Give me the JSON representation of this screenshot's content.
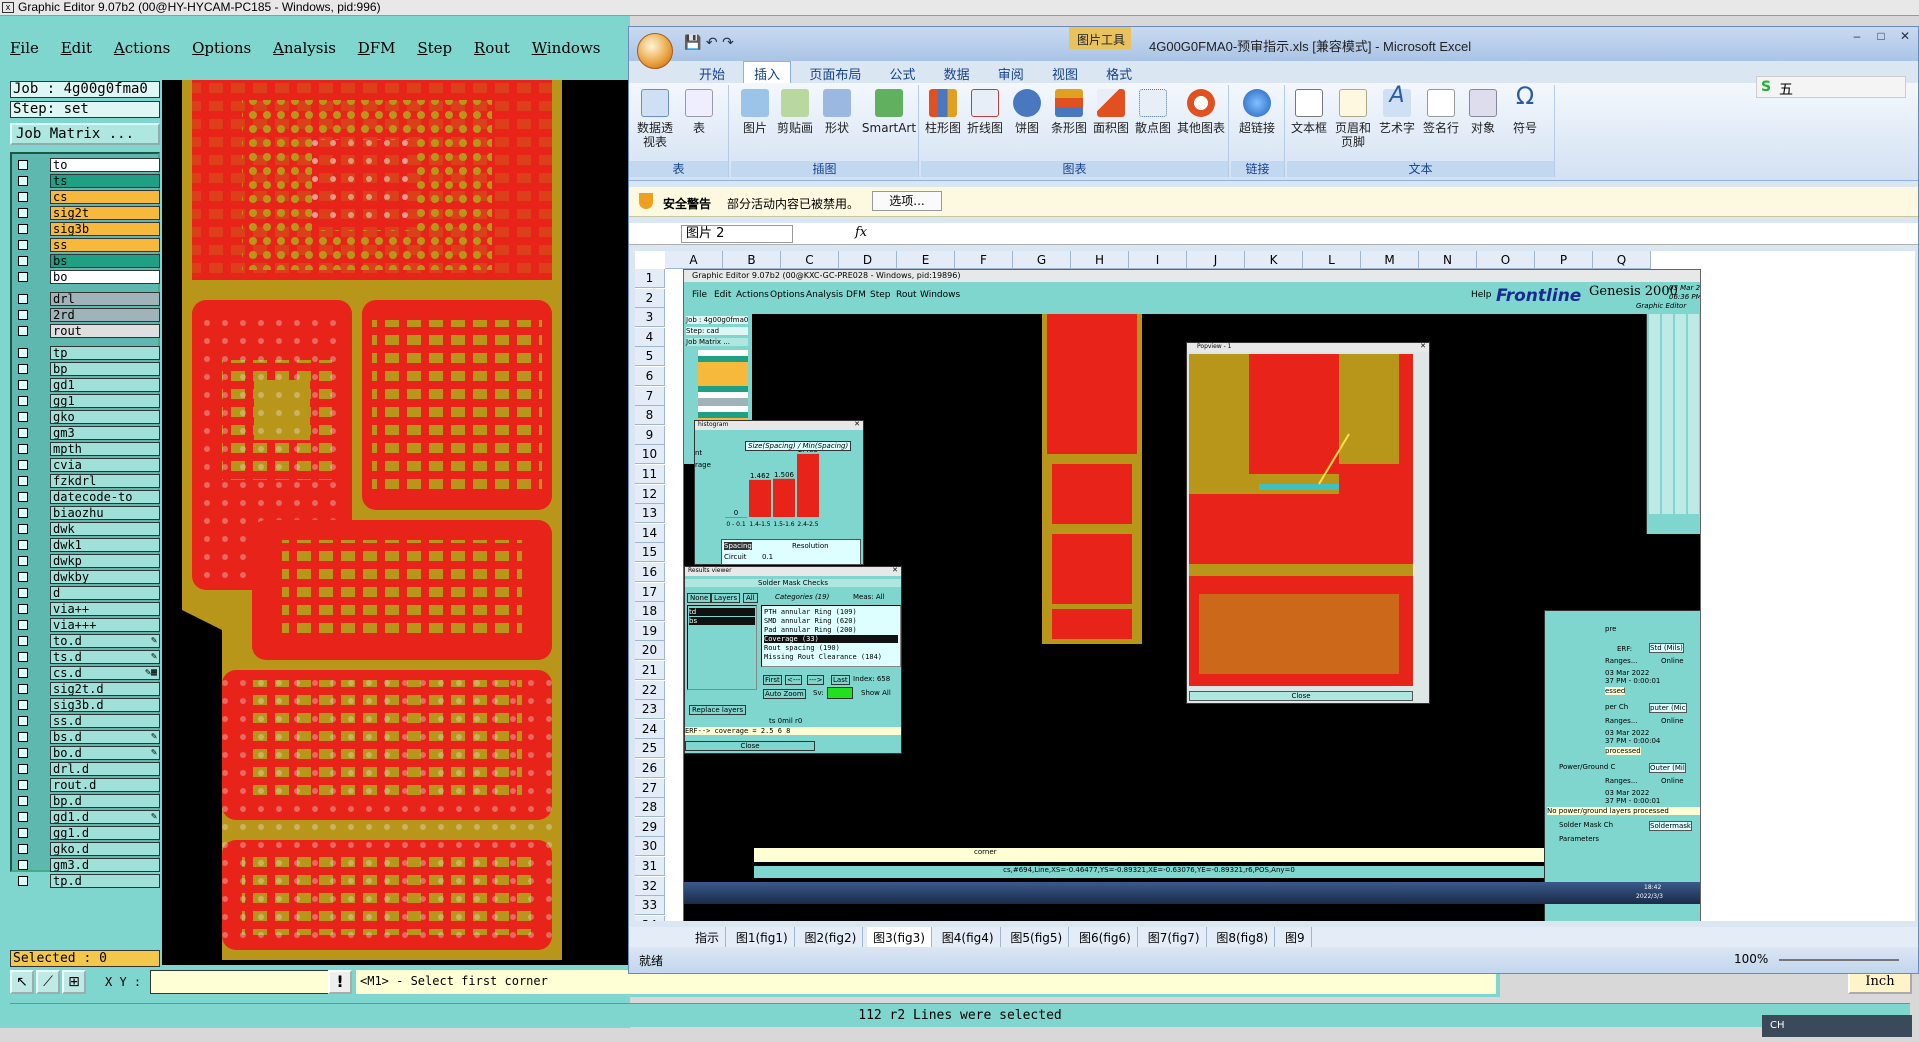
{
  "ge": {
    "title": "Graphic Editor 9.07b2 (00@HY-HYCAM-PC185 - Windows, pid:996)",
    "menu": [
      "File",
      "Edit",
      "Actions",
      "Options",
      "Analysis",
      "DFM",
      "Step",
      "Rout",
      "Windows"
    ],
    "job": "Job : 4g00g0fma0",
    "step": "Step: set",
    "job_matrix": "Job Matrix ...",
    "selected": "Selected : 0",
    "xy_label": "X Y :",
    "excl": "!",
    "prompt": "<M1> - Select first corner",
    "status": "112 r2 Lines were selected",
    "units": "Inch",
    "tray": "CH",
    "layers": [
      {
        "name": "to",
        "color": "#ffffff",
        "flag": ""
      },
      {
        "name": "ts",
        "color": "#1f9f84",
        "flag": ""
      },
      {
        "name": "cs",
        "color": "#f6b93b",
        "flag": ""
      },
      {
        "name": "sig2t",
        "color": "#f6b93b",
        "flag": ""
      },
      {
        "name": "sig3b",
        "color": "#f6b93b",
        "flag": ""
      },
      {
        "name": "ss",
        "color": "#f6b93b",
        "flag": ""
      },
      {
        "name": "bs",
        "color": "#1f9f84",
        "flag": ""
      },
      {
        "name": "bo",
        "color": "#ffffff",
        "flag": ""
      },
      {
        "name": "drl",
        "color": "#9fb3b8",
        "flag": "",
        "gap": true
      },
      {
        "name": "2rd",
        "color": "#9fb3b8",
        "flag": ""
      },
      {
        "name": "rout",
        "color": "#dfdfdf",
        "flag": ""
      },
      {
        "name": "tp",
        "color": "#9fe0d8",
        "flag": "",
        "gap": true
      },
      {
        "name": "bp",
        "color": "#9fe0d8",
        "flag": ""
      },
      {
        "name": "gd1",
        "color": "#9fe0d8",
        "flag": ""
      },
      {
        "name": "gg1",
        "color": "#9fe0d8",
        "flag": ""
      },
      {
        "name": "gko",
        "color": "#9fe0d8",
        "flag": ""
      },
      {
        "name": "gm3",
        "color": "#9fe0d8",
        "flag": ""
      },
      {
        "name": "mpth",
        "color": "#9fe0d8",
        "flag": ""
      },
      {
        "name": "cvia",
        "color": "#9fe0d8",
        "flag": ""
      },
      {
        "name": "fzkdrl",
        "color": "#9fe0d8",
        "flag": ""
      },
      {
        "name": "datecode-to",
        "color": "#9fe0d8",
        "flag": ""
      },
      {
        "name": "biaozhu",
        "color": "#9fe0d8",
        "flag": ""
      },
      {
        "name": "dwk",
        "color": "#9fe0d8",
        "flag": ""
      },
      {
        "name": "dwk1",
        "color": "#9fe0d8",
        "flag": ""
      },
      {
        "name": "dwkp",
        "color": "#9fe0d8",
        "flag": ""
      },
      {
        "name": "dwkby",
        "color": "#9fe0d8",
        "flag": ""
      },
      {
        "name": "d",
        "color": "#9fe0d8",
        "flag": ""
      },
      {
        "name": "via++",
        "color": "#9fe0d8",
        "flag": ""
      },
      {
        "name": "via+++",
        "color": "#9fe0d8",
        "flag": ""
      },
      {
        "name": "to.d",
        "color": "#9fe0d8",
        "flag": "✎"
      },
      {
        "name": "ts.d",
        "color": "#9fe0d8",
        "flag": "✎"
      },
      {
        "name": "cs.d",
        "color": "#9fe0d8",
        "flag": "✎▦"
      },
      {
        "name": "sig2t.d",
        "color": "#9fe0d8",
        "flag": ""
      },
      {
        "name": "sig3b.d",
        "color": "#9fe0d8",
        "flag": ""
      },
      {
        "name": "ss.d",
        "color": "#9fe0d8",
        "flag": ""
      },
      {
        "name": "bs.d",
        "color": "#9fe0d8",
        "flag": "✎"
      },
      {
        "name": "bo.d",
        "color": "#9fe0d8",
        "flag": "✎"
      },
      {
        "name": "drl.d",
        "color": "#9fe0d8",
        "flag": ""
      },
      {
        "name": "rout.d",
        "color": "#9fe0d8",
        "flag": ""
      },
      {
        "name": "bp.d",
        "color": "#9fe0d8",
        "flag": ""
      },
      {
        "name": "gd1.d",
        "color": "#9fe0d8",
        "flag": "✎"
      },
      {
        "name": "gg1.d",
        "color": "#9fe0d8",
        "flag": ""
      },
      {
        "name": "gko.d",
        "color": "#9fe0d8",
        "flag": ""
      },
      {
        "name": "gm3.d",
        "color": "#9fe0d8",
        "flag": ""
      },
      {
        "name": "tp.d",
        "color": "#9fe0d8",
        "flag": ""
      }
    ]
  },
  "excel": {
    "context_tab": "图片工具",
    "title": "4G00G0FMA0-预审指示.xls [兼容模式] - Microsoft Excel",
    "tabs": [
      "开始",
      "插入",
      "页面布局",
      "公式",
      "数据",
      "审阅",
      "视图",
      "格式"
    ],
    "ribbon_groups": [
      {
        "name": "表",
        "buttons": [
          "数据透视表",
          "表"
        ]
      },
      {
        "name": "插图",
        "buttons": [
          "图片",
          "剪贴画",
          "形状",
          "SmartArt"
        ]
      },
      {
        "name": "图表",
        "buttons": [
          "柱形图",
          "折线图",
          "饼图",
          "条形图",
          "面积图",
          "散点图",
          "其他图表"
        ]
      },
      {
        "name": "链接",
        "buttons": [
          "超链接"
        ]
      },
      {
        "name": "文本",
        "buttons": [
          "文本框",
          "页眉和页脚",
          "艺术字",
          "签名行",
          "对象",
          "符号"
        ]
      }
    ],
    "security_title": "安全警告",
    "security_text": "部分活动内容已被禁用。",
    "security_btn": "选项...",
    "namebox": "图片 2",
    "fx": "fx",
    "columns": [
      "A",
      "B",
      "C",
      "D",
      "E",
      "F",
      "G",
      "H",
      "I",
      "J",
      "K",
      "L",
      "M",
      "N",
      "O",
      "P",
      "Q"
    ],
    "rows": [
      "1",
      "2",
      "3",
      "4",
      "5",
      "6",
      "7",
      "8",
      "9",
      "10",
      "11",
      "12",
      "13",
      "14",
      "15",
      "16",
      "17",
      "18",
      "19",
      "20",
      "21",
      "22",
      "23",
      "24",
      "25",
      "26",
      "27",
      "28",
      "29",
      "30",
      "31",
      "32",
      "33",
      "34"
    ],
    "sheets": [
      "指示",
      "图1(fig1)",
      "图2(fig2)",
      "图3(fig3)",
      "图4(fig4)",
      "图5(fig5)",
      "图6(fig6)",
      "图7(fig7)",
      "图8(fig8)",
      "图9"
    ],
    "status": "就绪",
    "zoom": "100%"
  },
  "embedded": {
    "title": "Graphic Editor 9.07b2 (00@KXC-GC-PRE028 - Windows, pid:19896)",
    "menu": [
      "File",
      "Edit",
      "Actions",
      "Options",
      "Analysis",
      "DFM",
      "Step",
      "Rout",
      "Windows"
    ],
    "help": "Help",
    "brand": "Frontline",
    "product": "Genesis 2000",
    "subproduct": "Graphic Editor",
    "date": "03 Mar 2022",
    "time": "06:36 PM",
    "job": "Job : 4g00g0fma0",
    "step": "Step: cad",
    "job_matrix": "Job Matrix ...",
    "histogram": {
      "window": "histogram",
      "title": "Size(Spacing) / Min(Spacing)",
      "bars": [
        0,
        1.462,
        1.506,
        2.485
      ],
      "bins": [
        "0 - 0.1",
        "1.4-1.5",
        "1.5-1.6",
        "2.4-2.5"
      ],
      "left_labels": [
        "nt",
        "rage"
      ],
      "rows": [
        {
          "a": "Spacing",
          "b": "Resolution"
        },
        {
          "a": "Circuit",
          "b": "0.1"
        }
      ]
    },
    "results": {
      "window": "Results viewer",
      "header": "Solder Mask Checks",
      "filters": [
        "None",
        "Layers",
        "All"
      ],
      "categories_label": "Categories (19)",
      "meas": "Meas: All",
      "layers": [
        "td",
        "bs"
      ],
      "categories": [
        "PTH annular Ring (109)",
        "SMD annular Ring (620)",
        "Pad annular Ring (200)",
        "Coverage (33)",
        "Rout spacing (190)",
        "Missing Rout Clearance (184)"
      ],
      "nav": [
        "First",
        "<---",
        "--->",
        "Last"
      ],
      "index": "Index: 658",
      "auto_zoom": "Auto Zoom",
      "sv": "Sv:",
      "show_all": "Show All",
      "replace": "Replace layers",
      "erf": "ERF--> coverage = 2.5 6 8",
      "ts_label": "ts 0mil r0",
      "close": "Close"
    },
    "popview": {
      "title": "Popview - 1",
      "close": "Close"
    },
    "status_text": "corner",
    "coord_text": "cs,#694,Line,XS=-0.46477,YS=-0.89321,XE=-0.63076,YE=-0.89321,r6,POS,Any=0",
    "right_panel": [
      {
        "title": "pre",
        "erf": "Std (Mils)",
        "date": "03 Mar 2022",
        "time": "37 PM - 0:00:01",
        "status": "essed"
      },
      {
        "title": "per Ch",
        "erf": "puter (Mic",
        "date": "03 Mar 2022",
        "time": "37 PM - 0:00:04",
        "status": "processed"
      },
      {
        "title": "Power/Ground C",
        "erf": "Outer (Mil",
        "date": "03 Mar 2022",
        "time": "37 PM - 0:00:01",
        "status": "No power/ground layers processed"
      },
      {
        "title": "Solder Mask Ch",
        "erf": "Soldermask",
        "date": "",
        "time": "",
        "status": ""
      }
    ],
    "panel_labels": {
      "ranges": "Ranges...",
      "online": "Online",
      "params": "Parameters",
      "erf": "ERF:"
    },
    "taskbar_time": "18:42",
    "taskbar_date": "2022/3/3"
  },
  "sogou": {
    "label": "五"
  }
}
